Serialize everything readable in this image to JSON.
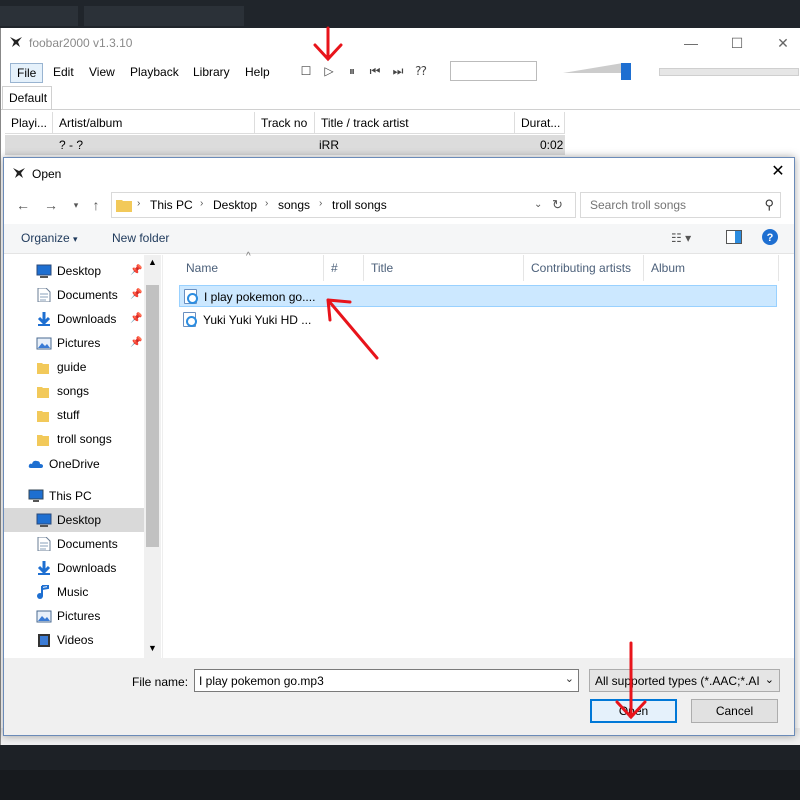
{
  "app": {
    "title": "foobar2000 v1.3.10",
    "menu": [
      "File",
      "Edit",
      "View",
      "Playback",
      "Library",
      "Help"
    ],
    "playlist_tab": "Default",
    "columns": [
      "Playi...",
      "Artist/album",
      "Track no",
      "Title / track artist",
      "Durat..."
    ],
    "row": {
      "artist_album": "? - ?",
      "title": "iRR",
      "duration": "0:02"
    }
  },
  "dialog": {
    "title": "Open",
    "address": [
      "This PC",
      "Desktop",
      "songs",
      "troll songs"
    ],
    "search_placeholder": "Search troll songs",
    "organize_label": "Organize",
    "new_folder_label": "New folder",
    "nav_quick": [
      {
        "label": "Desktop",
        "icon": "desktop-icon",
        "pinned": true
      },
      {
        "label": "Documents",
        "icon": "document-icon",
        "pinned": true
      },
      {
        "label": "Downloads",
        "icon": "download-icon",
        "pinned": true
      },
      {
        "label": "Pictures",
        "icon": "picture-icon",
        "pinned": true
      },
      {
        "label": "guide",
        "icon": "folder-icon",
        "pinned": false
      },
      {
        "label": "songs",
        "icon": "folder-icon",
        "pinned": false
      },
      {
        "label": "stuff",
        "icon": "folder-icon",
        "pinned": false
      },
      {
        "label": "troll songs",
        "icon": "folder-icon",
        "pinned": false
      }
    ],
    "onedrive_label": "OneDrive",
    "thispc_label": "This PC",
    "nav_pc": [
      {
        "label": "Desktop",
        "icon": "desktop-icon",
        "selected": true
      },
      {
        "label": "Documents",
        "icon": "document-icon",
        "selected": false
      },
      {
        "label": "Downloads",
        "icon": "download-icon",
        "selected": false
      },
      {
        "label": "Music",
        "icon": "music-icon",
        "selected": false
      },
      {
        "label": "Pictures",
        "icon": "picture-icon",
        "selected": false
      },
      {
        "label": "Videos",
        "icon": "video-icon",
        "selected": false
      }
    ],
    "file_columns": [
      "Name",
      "#",
      "Title",
      "Contributing artists",
      "Album"
    ],
    "files": [
      {
        "name": "I play pokemon go....",
        "selected": true
      },
      {
        "name": "Yuki Yuki Yuki HD ...",
        "selected": false
      }
    ],
    "file_name_label": "File name:",
    "file_name_value": "I play pokemon go.mp3",
    "file_type": "All supported types (*.AAC;*.AI",
    "open_label": "Open",
    "cancel_label": "Cancel"
  },
  "colors": {
    "accent": "#0078d7",
    "selection": "#cce8ff",
    "annotation_arrow": "#e8141b"
  }
}
